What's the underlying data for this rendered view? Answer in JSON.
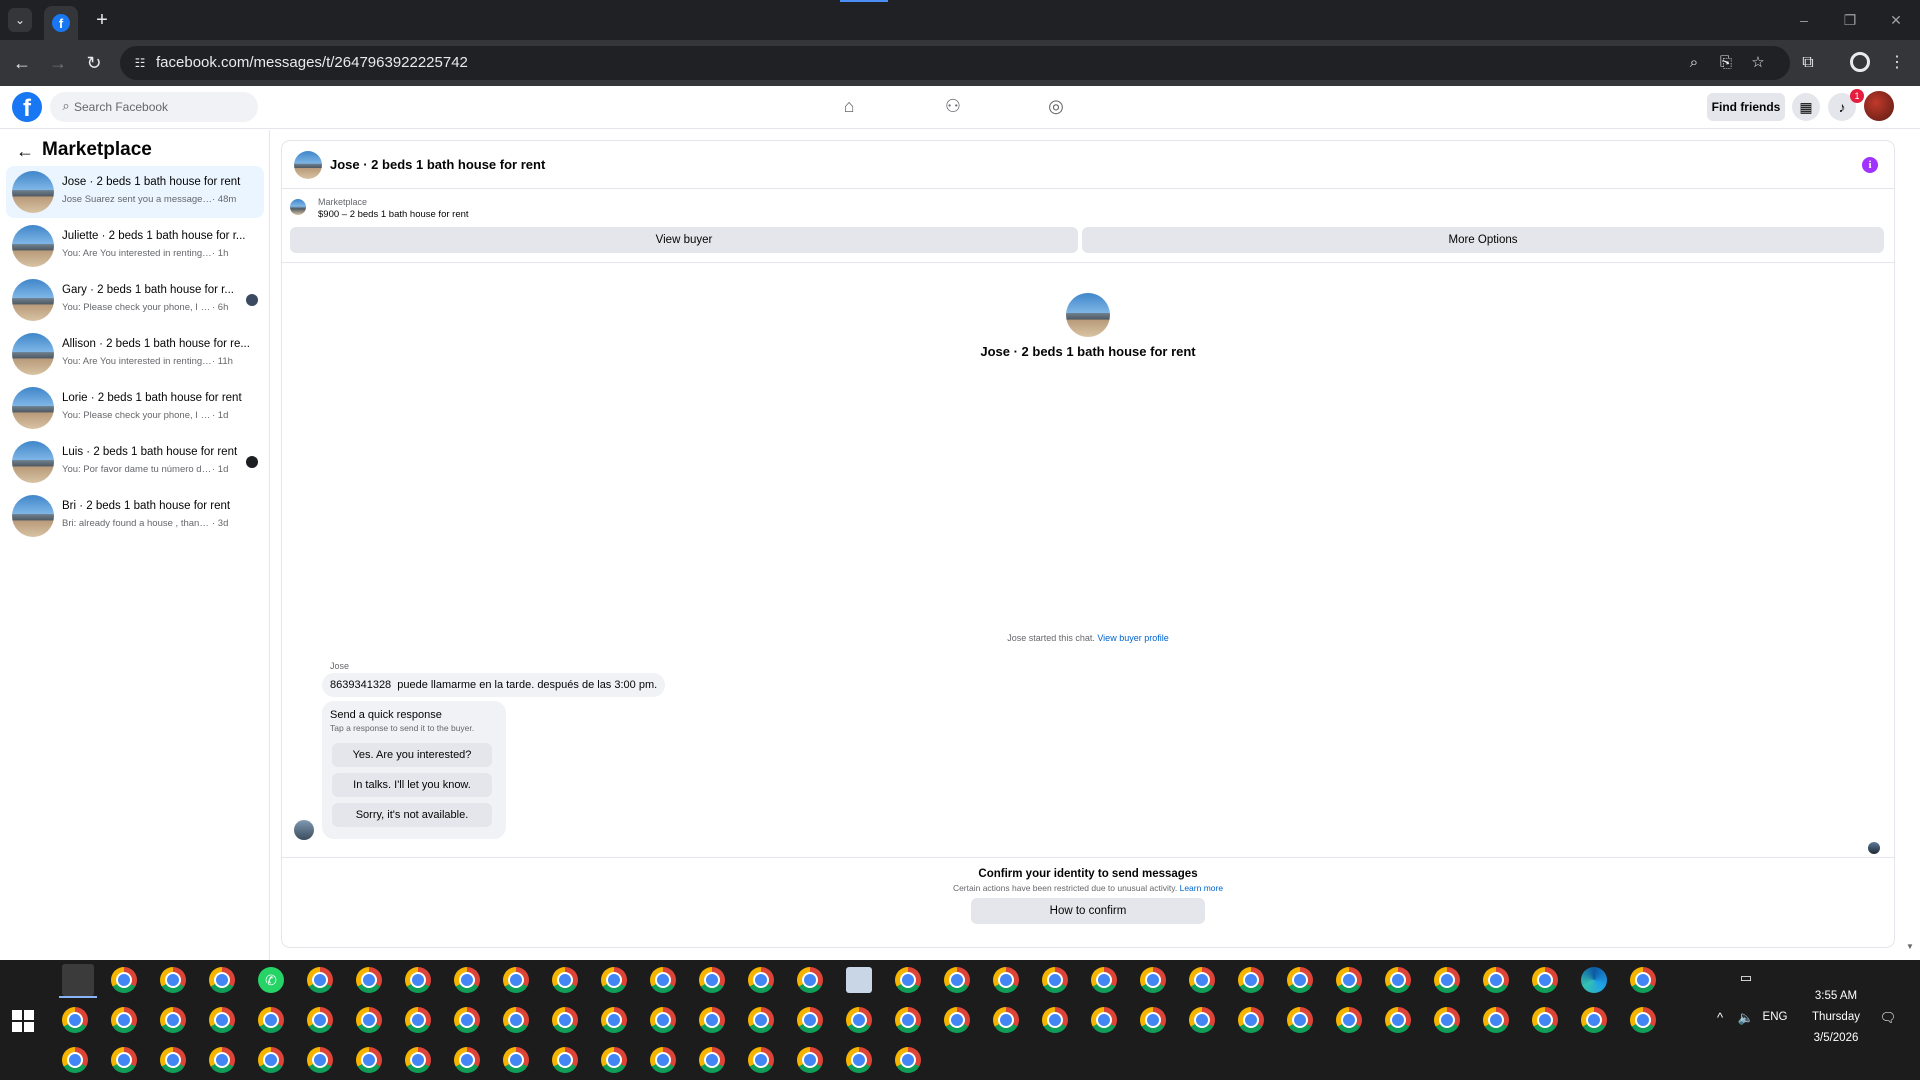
{
  "browser": {
    "url": "facebook.com/messages/t/2647963922225742",
    "tab_favicon": "f",
    "new_tab": "+",
    "window_controls": {
      "minimize": "–",
      "restore": "❐",
      "close": "✕"
    }
  },
  "fb_header": {
    "logo": "f",
    "search_placeholder": "Search Facebook",
    "find_friends_label": "Find friends",
    "notification_count": "1",
    "icons": [
      "home-icon",
      "friends-icon",
      "groups-icon",
      "menu-grid-icon",
      "bell-icon"
    ]
  },
  "sidebar": {
    "title": "Marketplace",
    "conversations": [
      {
        "title": "Jose · 2 beds 1 bath house for rent",
        "snippet": "Jose Suarez sent you a message ab...",
        "time": "· 48m",
        "unread": false,
        "active": true
      },
      {
        "title": "Juliette · 2 beds 1 bath house for r...",
        "snippet": "You: Are You interested in renting Ple...",
        "time": "· 1h",
        "unread": false,
        "active": false
      },
      {
        "title": "Gary · 2 beds 1 bath house for r...",
        "snippet": "You: Please check your phone, I ha...",
        "time": "· 6h",
        "unread": true,
        "active": false
      },
      {
        "title": "Allison · 2 beds 1 bath house for re...",
        "snippet": "You: Are You interested in renting Pl...",
        "time": "· 11h",
        "unread": false,
        "active": false
      },
      {
        "title": "Lorie · 2 beds 1 bath house for rent",
        "snippet": "You: Please check your phone, I have t...",
        "time": "· 1d",
        "unread": false,
        "active": false
      },
      {
        "title": "Luis · 2 beds 1 bath house for rent",
        "snippet": "You: Por favor dame tu número de ...",
        "time": "· 1d",
        "unread": true,
        "active": false
      },
      {
        "title": "Bri · 2 beds 1 bath house for rent",
        "snippet": "Bri: already found a house , thankyou",
        "time": "· 3d",
        "unread": false,
        "active": false
      }
    ]
  },
  "chat": {
    "header_title": "Jose · 2 beds 1 bath house for rent",
    "listing_label": "Marketplace",
    "listing_price": "$900 – 2 beds 1 bath house for rent",
    "view_buyer_label": "View buyer",
    "more_options_label": "More Options",
    "hero_title": "Jose · 2 beds 1 bath house for rent",
    "started_text": "Jose started this chat.",
    "view_buyer_profile": "View buyer profile",
    "sender_name": "Jose",
    "message": "8639341328  puede llamarme en la tarde. después de las 3:00 pm.",
    "quick_response_title": "Send a quick response",
    "quick_response_sub": "Tap a response to send it to the buyer.",
    "quick_responses": [
      "Yes. Are you interested?",
      "In talks. I'll let you know.",
      "Sorry, it's not available."
    ],
    "confirm_title": "Confirm your identity to send messages",
    "confirm_sub": "Certain actions have been restricted due to unusual activity.",
    "learn_more": "Learn more",
    "how_to_confirm": "How to confirm"
  },
  "taskbar": {
    "time": "3:55 AM",
    "day": "Thursday",
    "date": "3/5/2026",
    "language": "ENG",
    "tray_chevron": "^"
  }
}
